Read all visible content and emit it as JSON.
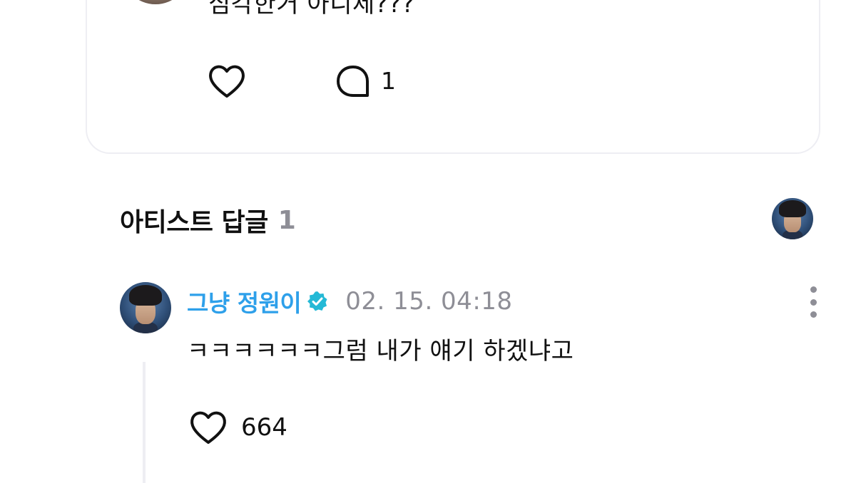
{
  "comment": {
    "text": "심각한거 아니제???",
    "like_icon": "heart-outline-icon",
    "reply_icon": "speech-bubble-icon",
    "reply_count": "1"
  },
  "artist_replies": {
    "title": "아티스트 답글",
    "count": "1"
  },
  "reply": {
    "author": "그냥 정원이",
    "verified_icon": "verified-badge-icon",
    "date": "02. 15. 04:18",
    "text": "ㅋㅋㅋㅋㅋㅋ그럼 내가 얘기 하겠냐고",
    "like_icon": "heart-outline-icon",
    "like_count": "664",
    "more_icon": "more-vertical-icon"
  },
  "colors": {
    "artist_name": "#2ea0ea",
    "verified_badge": "#24b9d6",
    "muted_text": "#8e8e96",
    "card_border": "#eeeef3"
  }
}
